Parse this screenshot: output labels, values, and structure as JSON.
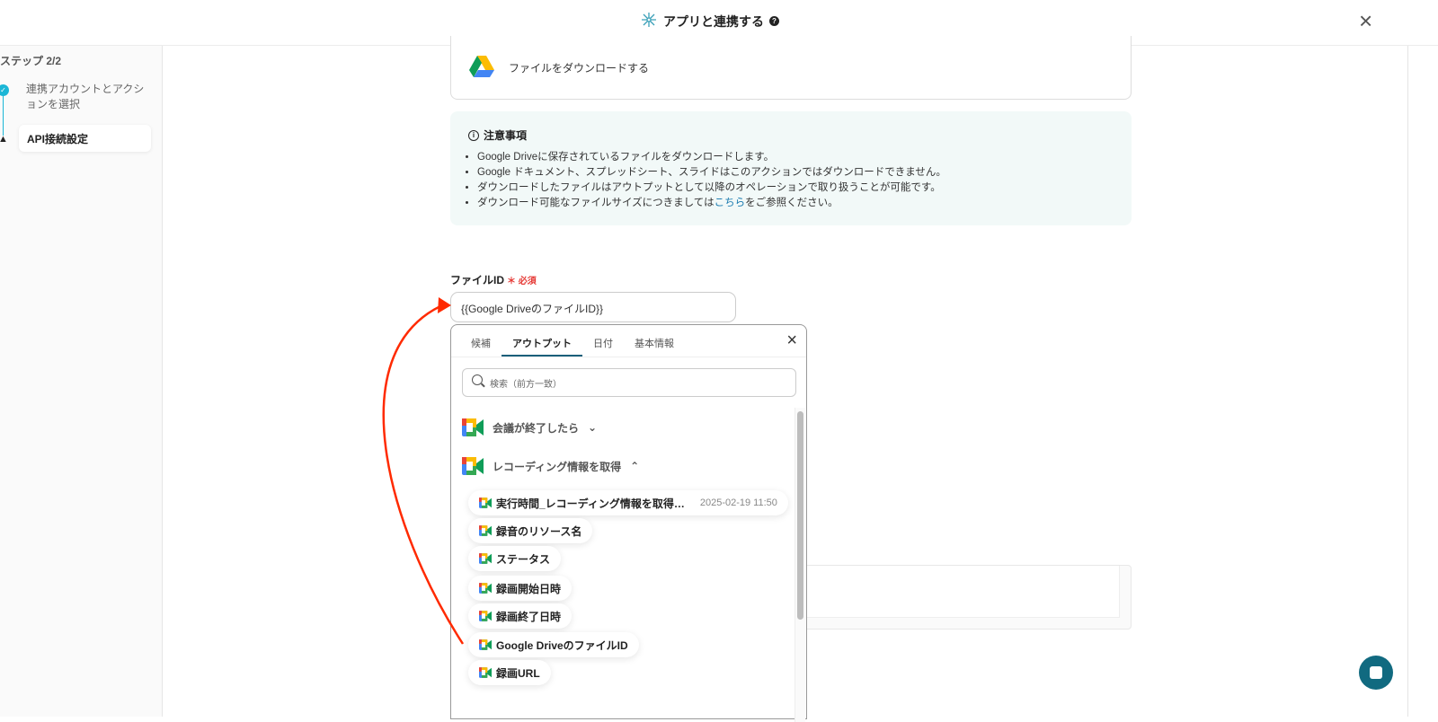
{
  "header": {
    "title": "アプリと連携する",
    "help": "?",
    "close": "×"
  },
  "sidebar": {
    "step": "ステップ 2/2",
    "steps": [
      {
        "label": "連携アカウントとアクションを選択",
        "status": "done"
      },
      {
        "label": "API接続設定",
        "status": "warning"
      }
    ]
  },
  "action": {
    "label": "ファイルをダウンロードする"
  },
  "notice": {
    "title": "注意事項",
    "items": [
      "Google Driveに保存されているファイルをダウンロードします。",
      "Google ドキュメント、スプレッドシート、スライドはこのアクションではダウンロードできません。",
      "ダウンロードしたファイルはアウトプットとして以降のオペレーションで取り扱うことが可能です。"
    ],
    "last_pre": "ダウンロード可能なファイルサイズにつきましては",
    "last_link": "こちら",
    "last_post": "をご参照ください。"
  },
  "field": {
    "label": "ファイルID",
    "required": "＊ 必須",
    "value": "{{Google DriveのファイルID}}"
  },
  "dropdown": {
    "tabs": [
      "候補",
      "アウトプット",
      "日付",
      "基本情報"
    ],
    "active_tab": 1,
    "search_placeholder": "検索（前方一致）",
    "groups": [
      {
        "label": "会議が終了したら",
        "expanded": false
      },
      {
        "label": "レコーディング情報を取得",
        "expanded": true
      }
    ],
    "items": [
      {
        "label": "実行時間_レコーディング情報を取得…",
        "value": "2025-02-19 11:50"
      },
      {
        "label": "録音のリソース名"
      },
      {
        "label": "ステータス"
      },
      {
        "label": "録画開始日時"
      },
      {
        "label": "録画終了日時"
      },
      {
        "label": "Google DriveのファイルID"
      },
      {
        "label": "録画URL"
      }
    ]
  },
  "colors": {
    "accent": "#1a5f7a",
    "arrow": "#ff2a00",
    "chat": "#116a80"
  }
}
